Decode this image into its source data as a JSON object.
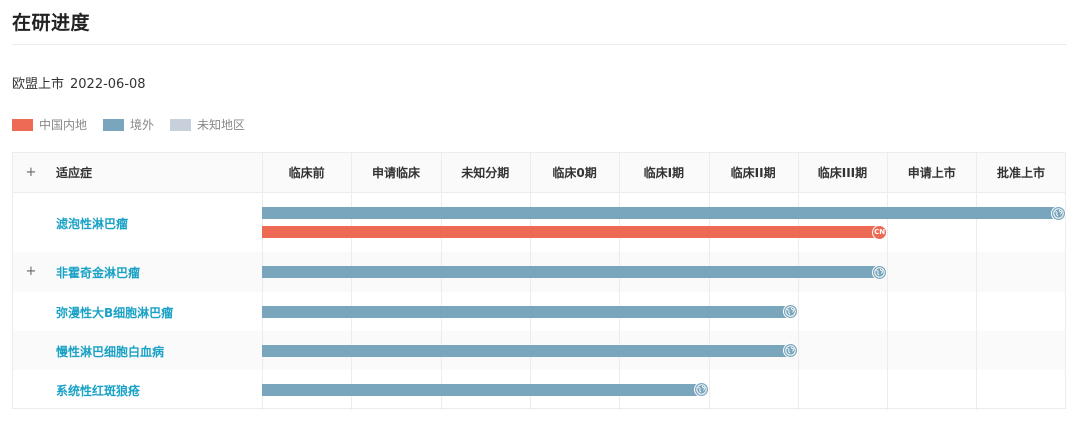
{
  "page_title": "在研进度",
  "status": {
    "label": "欧盟上市",
    "date": "2022-06-08"
  },
  "legend": [
    {
      "label": "中国内地",
      "color": "#ed6a55"
    },
    {
      "label": "境外",
      "color": "#79a6bc"
    },
    {
      "label": "未知地区",
      "color": "#c8d0dc"
    }
  ],
  "table": {
    "indication_header": "适应症",
    "expand_symbol": "+",
    "phases": [
      "临床前",
      "申请临床",
      "未知分期",
      "临床0期",
      "临床I期",
      "临床II期",
      "临床III期",
      "申请上市",
      "批准上市"
    ],
    "rows": [
      {
        "name": "滤泡性淋巴瘤",
        "expandable": false,
        "bars": [
          {
            "region": "境外",
            "reached_phase": "批准上市",
            "marker": "globe-icon"
          },
          {
            "region": "中国内地",
            "reached_phase": "临床III期",
            "marker": "CN"
          }
        ]
      },
      {
        "name": "非霍奇金淋巴瘤",
        "expandable": true,
        "bars": [
          {
            "region": "境外",
            "reached_phase": "临床III期",
            "marker": "globe-icon"
          }
        ]
      },
      {
        "name": "弥漫性大B细胞淋巴瘤",
        "expandable": false,
        "bars": [
          {
            "region": "境外",
            "reached_phase": "临床II期",
            "marker": "globe-icon"
          }
        ]
      },
      {
        "name": "慢性淋巴细胞白血病",
        "expandable": false,
        "bars": [
          {
            "region": "境外",
            "reached_phase": "临床II期",
            "marker": "globe-icon"
          }
        ]
      },
      {
        "name": "系统性红斑狼疮",
        "expandable": false,
        "bars": [
          {
            "region": "境外",
            "reached_phase": "临床I期",
            "marker": "globe-icon"
          }
        ]
      }
    ]
  }
}
